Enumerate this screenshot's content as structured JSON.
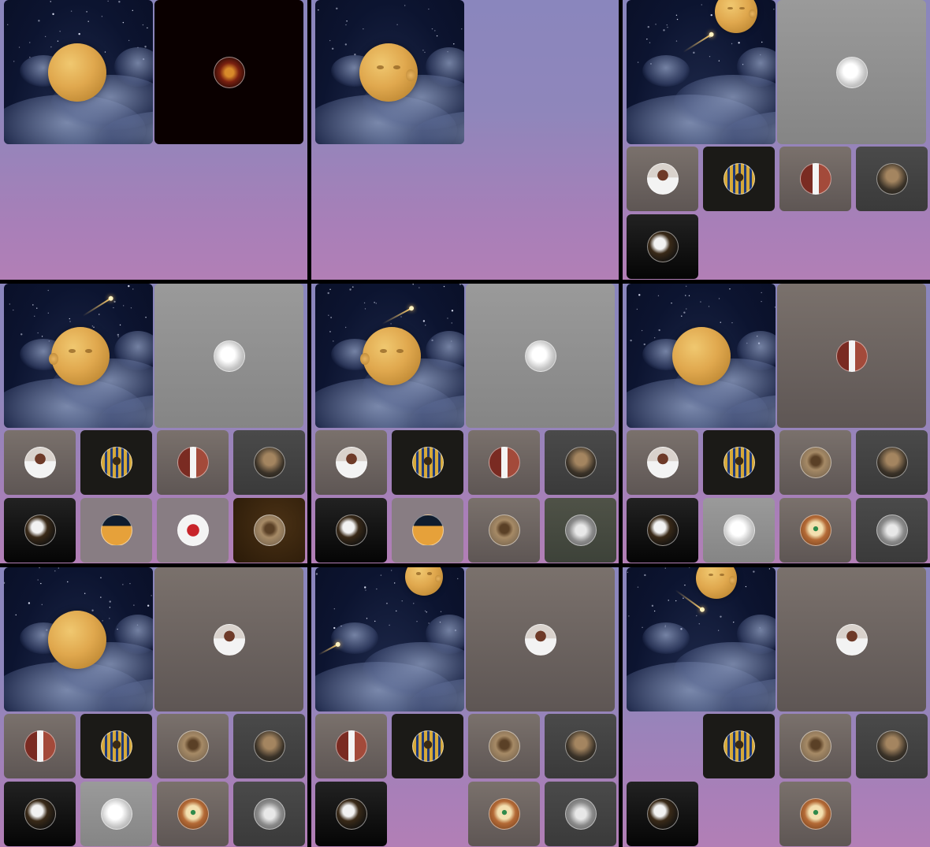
{
  "screens": [
    {
      "id": "s1"
    },
    {
      "id": "s2"
    },
    {
      "id": "s3"
    },
    {
      "id": "s4"
    },
    {
      "id": "s5"
    },
    {
      "id": "s6"
    },
    {
      "id": "s7"
    },
    {
      "id": "s8"
    },
    {
      "id": "s9"
    }
  ],
  "colors": {
    "background_top": "#8a86bd",
    "background_bottom": "#b27fb6",
    "night_sky": "#0c1430",
    "moon": "#e0a84e",
    "divider": "#000000"
  },
  "icons": [
    "moon-face-icon",
    "shooting-star-icon",
    "cloud-icon",
    "avatar-icon"
  ]
}
